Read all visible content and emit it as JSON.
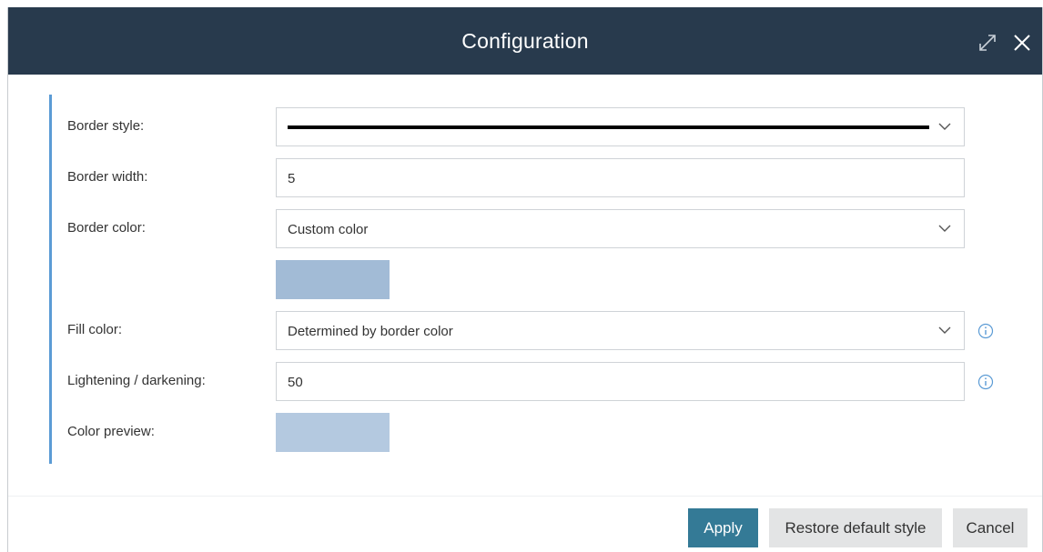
{
  "dialog": {
    "title": "Configuration",
    "expand_icon": "expand-arrows-icon",
    "close_icon": "close-icon"
  },
  "form": {
    "border_style": {
      "label": "Border style:",
      "value": "solid line",
      "line_color": "#000000"
    },
    "border_width": {
      "label": "Border width:",
      "value": "5"
    },
    "border_color": {
      "label": "Border color:",
      "value": "Custom color",
      "swatch_color": "#a2bbd6"
    },
    "fill_color": {
      "label": "Fill color:",
      "value": "Determined by border color",
      "info_icon": "info-icon"
    },
    "lightening": {
      "label": "Lightening / darkening:",
      "value": "50",
      "info_icon": "info-icon"
    },
    "color_preview": {
      "label": "Color preview:",
      "swatch_color": "#b4c9e0"
    }
  },
  "footer": {
    "apply_label": "Apply",
    "restore_label": "Restore default style",
    "cancel_label": "Cancel"
  },
  "colors": {
    "title_bar": "#283a4d",
    "accent_bar": "#5b9bd5",
    "apply_button": "#347a96",
    "secondary_button": "#e3e4e5"
  }
}
